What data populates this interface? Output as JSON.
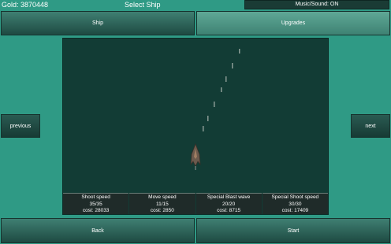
{
  "header": {
    "gold": "Gold: 3870448",
    "title": "Select Ship",
    "music": "Music/Sound: ON"
  },
  "tabs": {
    "ship": "Ship",
    "upgrades": "Upgrades"
  },
  "nav": {
    "previous": "previous",
    "next": "next"
  },
  "stats": [
    {
      "name": "Shoot speed",
      "level": "35/35",
      "cost": "cost: 28033"
    },
    {
      "name": "Move speed",
      "level": "11/15",
      "cost": "cost: 2850"
    },
    {
      "name": "Special Blast wave",
      "level": "20/20",
      "cost": "cost: 8715"
    },
    {
      "name": "Special Shoot speed",
      "level": "30/30",
      "cost": "cost: 17409"
    }
  ],
  "footer": {
    "back": "Back",
    "start": "Start"
  },
  "colors": {
    "background": "#2f9a85",
    "preview": "#123c35",
    "ship": "#6b5a4d"
  }
}
